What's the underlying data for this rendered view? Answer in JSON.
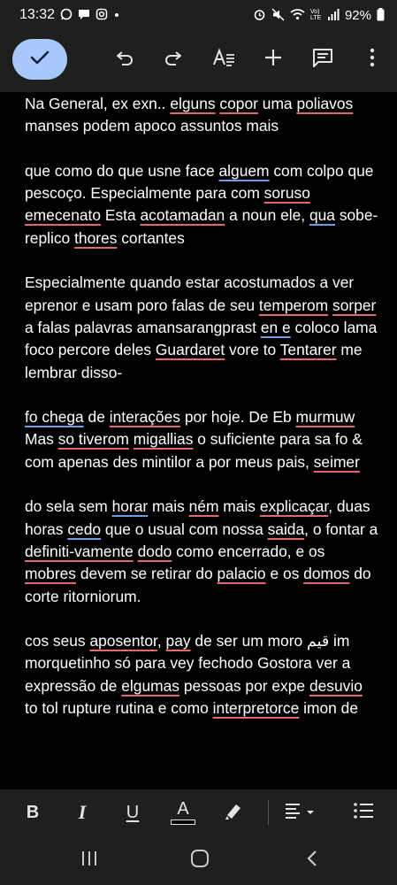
{
  "status_bar": {
    "time": "13:32",
    "battery": "92%",
    "volte_label": "Vo) LTE"
  },
  "toolbar": {
    "done_icon": "check-icon",
    "icons": [
      "undo-icon",
      "redo-icon",
      "text-format-icon",
      "insert-plus-icon",
      "comment-icon",
      "more-vert-icon"
    ]
  },
  "document": {
    "paragraphs": [
      [
        {
          "t": "Na General, ex exn.. "
        },
        {
          "t": "elguns",
          "m": "sp"
        },
        {
          "t": " "
        },
        {
          "t": "copor",
          "m": "sp"
        },
        {
          "t": " uma "
        },
        {
          "t": "poliavos",
          "m": "sp"
        },
        {
          "t": " manses podem apoco assuntos mais"
        }
      ],
      [
        {
          "t": "que como do que usne face "
        },
        {
          "t": "alguem",
          "m": "gr"
        },
        {
          "t": " com colpo que pescoço. Especialmente para com "
        },
        {
          "t": "soruso",
          "m": "sp"
        },
        {
          "t": " "
        },
        {
          "t": "emecenato",
          "m": "sp"
        },
        {
          "t": " Esta "
        },
        {
          "t": "acotamadan",
          "m": "sp"
        },
        {
          "t": " a noun ele, "
        },
        {
          "t": "qua",
          "m": "gr"
        },
        {
          "t": " sobe-replico "
        },
        {
          "t": "thores",
          "m": "sp"
        },
        {
          "t": " cortantes"
        }
      ],
      [
        {
          "t": "Especialmente quando estar acostumados a ver eprenor e usam poro falas de seu "
        },
        {
          "t": "temperom",
          "m": "sp"
        },
        {
          "t": " "
        },
        {
          "t": "sorper",
          "m": "sp"
        },
        {
          "t": " a falas palavras amansarangprast "
        },
        {
          "t": "en e",
          "m": "gr"
        },
        {
          "t": " coloco lama foco percore deles "
        },
        {
          "t": "Guardaret",
          "m": "sp"
        },
        {
          "t": " vore to "
        },
        {
          "t": "Tentarer",
          "m": "sp"
        },
        {
          "t": " me lembrar disso-"
        }
      ],
      [
        {
          "t": "fo chega",
          "m": "gr"
        },
        {
          "t": " de "
        },
        {
          "t": "interações",
          "m": "sp"
        },
        {
          "t": " por hoje. De Eb "
        },
        {
          "t": "murmuw",
          "m": "sp"
        },
        {
          "t": " Mas "
        },
        {
          "t": "so tiverom",
          "m": "sp"
        },
        {
          "t": " "
        },
        {
          "t": "migallias",
          "m": "sp"
        },
        {
          "t": " o suficiente para sa fo & com apenas des mintilor a por meus pais, "
        },
        {
          "t": "seimer",
          "m": "sp"
        }
      ],
      [
        {
          "t": "do sela sem "
        },
        {
          "t": "horar",
          "m": "gr"
        },
        {
          "t": " mais "
        },
        {
          "t": "ném",
          "m": "sp"
        },
        {
          "t": " mais "
        },
        {
          "t": "explicaçar",
          "m": "sp"
        },
        {
          "t": ", duas horas "
        },
        {
          "t": "cedo",
          "m": "gr"
        },
        {
          "t": " que o usual com nossa "
        },
        {
          "t": "saida",
          "m": "sp"
        },
        {
          "t": ", o fontar a "
        },
        {
          "t": "definiti-vamente",
          "m": "sp"
        },
        {
          "t": " "
        },
        {
          "t": "dodo",
          "m": "sp"
        },
        {
          "t": " como encerrado, e os "
        },
        {
          "t": "mobres",
          "m": "sp"
        },
        {
          "t": " devem se retirar do "
        },
        {
          "t": "palacio",
          "m": "sp"
        },
        {
          "t": " e os "
        },
        {
          "t": "domos",
          "m": "sp"
        },
        {
          "t": " do corte ritorniorum."
        }
      ],
      [
        {
          "t": "cos seus "
        },
        {
          "t": "aposentor",
          "m": "sp"
        },
        {
          "t": ", "
        },
        {
          "t": "pay",
          "m": "sp"
        },
        {
          "t": " de ser um moro قيم im morquetinho só para vey fechodo Gostora ver a expressão de "
        },
        {
          "t": "elgumas",
          "m": "sp"
        },
        {
          "t": " pessoas por expe "
        },
        {
          "t": "desuvio",
          "m": "sp"
        },
        {
          "t": " to tol rupture rutina e como "
        },
        {
          "t": "interpretorce",
          "m": "sp"
        },
        {
          "t": " imon de"
        }
      ]
    ]
  },
  "format_bar": {
    "bold_label": "B",
    "italic_label": "I",
    "underline_label": "U",
    "text_color_label": "A",
    "text_color_swatch": "#000000"
  },
  "nav": {
    "icons": [
      "recents-icon",
      "home-icon",
      "back-icon"
    ]
  },
  "colors": {
    "accent": "#a8c7fa",
    "spelling_underline": "#e06a6a",
    "grammar_underline": "#6f9ce8"
  }
}
